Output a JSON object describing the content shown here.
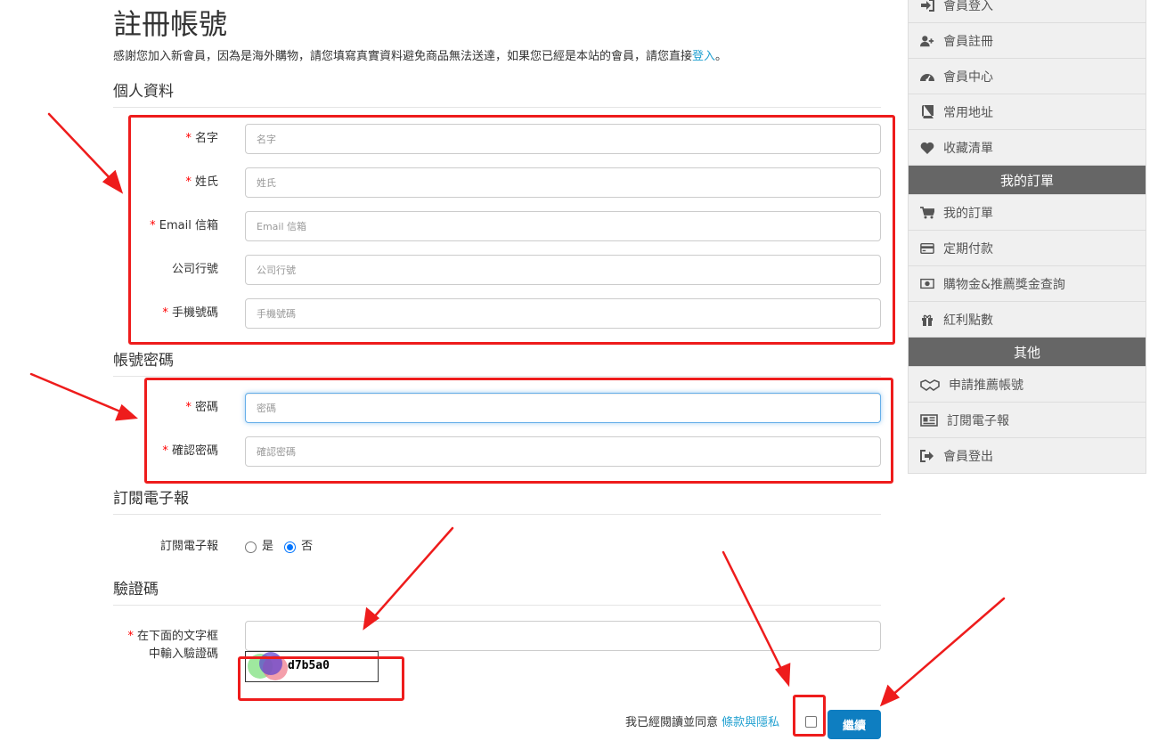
{
  "page": {
    "title": "註冊帳號",
    "intro_text": "感謝您加入新會員，因為是海外購物，請您填寫真實資料避免商品無法送達，如果您已經是本站的會員，請您直接",
    "intro_link": "登入",
    "intro_end": "。"
  },
  "sections": {
    "personal": "個人資料",
    "account": "帳號密碼",
    "newsletter": "訂閱電子報",
    "captcha": "驗證碼"
  },
  "required_mark": "*",
  "fields": {
    "firstname": {
      "label": "名字",
      "placeholder": "名字"
    },
    "lastname": {
      "label": "姓氏",
      "placeholder": "姓氏"
    },
    "email": {
      "label": "Email 信箱",
      "placeholder": "Email 信箱"
    },
    "company": {
      "label": "公司行號",
      "placeholder": "公司行號"
    },
    "telephone": {
      "label": "手機號碼",
      "placeholder": "手機號碼"
    },
    "password": {
      "label": "密碼",
      "placeholder": "密碼"
    },
    "confirm": {
      "label": "確認密碼",
      "placeholder": "確認密碼"
    }
  },
  "newsletter": {
    "label": "訂閱電子報",
    "yes": "是",
    "no": "否",
    "selected": "否"
  },
  "captcha": {
    "label_line1": "在下面的文字框",
    "label_line2": "中輸入驗證碼",
    "code": "d7b5a0"
  },
  "agree": {
    "text": "我已經閱讀並同意",
    "link": "條款與隱私",
    "checked": false
  },
  "buttons": {
    "continue": "繼續"
  },
  "sidebar": {
    "account_items": [
      {
        "label": "會員登入",
        "icon": "sign-in-icon"
      },
      {
        "label": "會員註冊",
        "icon": "user-plus-icon"
      },
      {
        "label": "會員中心",
        "icon": "dashboard-icon"
      },
      {
        "label": "常用地址",
        "icon": "book-icon"
      },
      {
        "label": "收藏清單",
        "icon": "heart-icon"
      }
    ],
    "orders_heading": "我的訂單",
    "order_items": [
      {
        "label": "我的訂單",
        "icon": "cart-icon"
      },
      {
        "label": "定期付款",
        "icon": "credit-card-icon"
      },
      {
        "label": "購物金&推薦獎金查詢",
        "icon": "money-icon"
      },
      {
        "label": "紅利點數",
        "icon": "gift-icon"
      }
    ],
    "other_heading": "其他",
    "other_items": [
      {
        "label": "申請推薦帳號",
        "icon": "handshake-icon"
      },
      {
        "label": "訂閱電子報",
        "icon": "newspaper-icon"
      },
      {
        "label": "會員登出",
        "icon": "sign-out-icon"
      }
    ]
  },
  "colors": {
    "annotation": "#ee1c1c",
    "link": "#23a1d1",
    "button": "#0e7ec1",
    "sidebar_heading": "#666666"
  }
}
